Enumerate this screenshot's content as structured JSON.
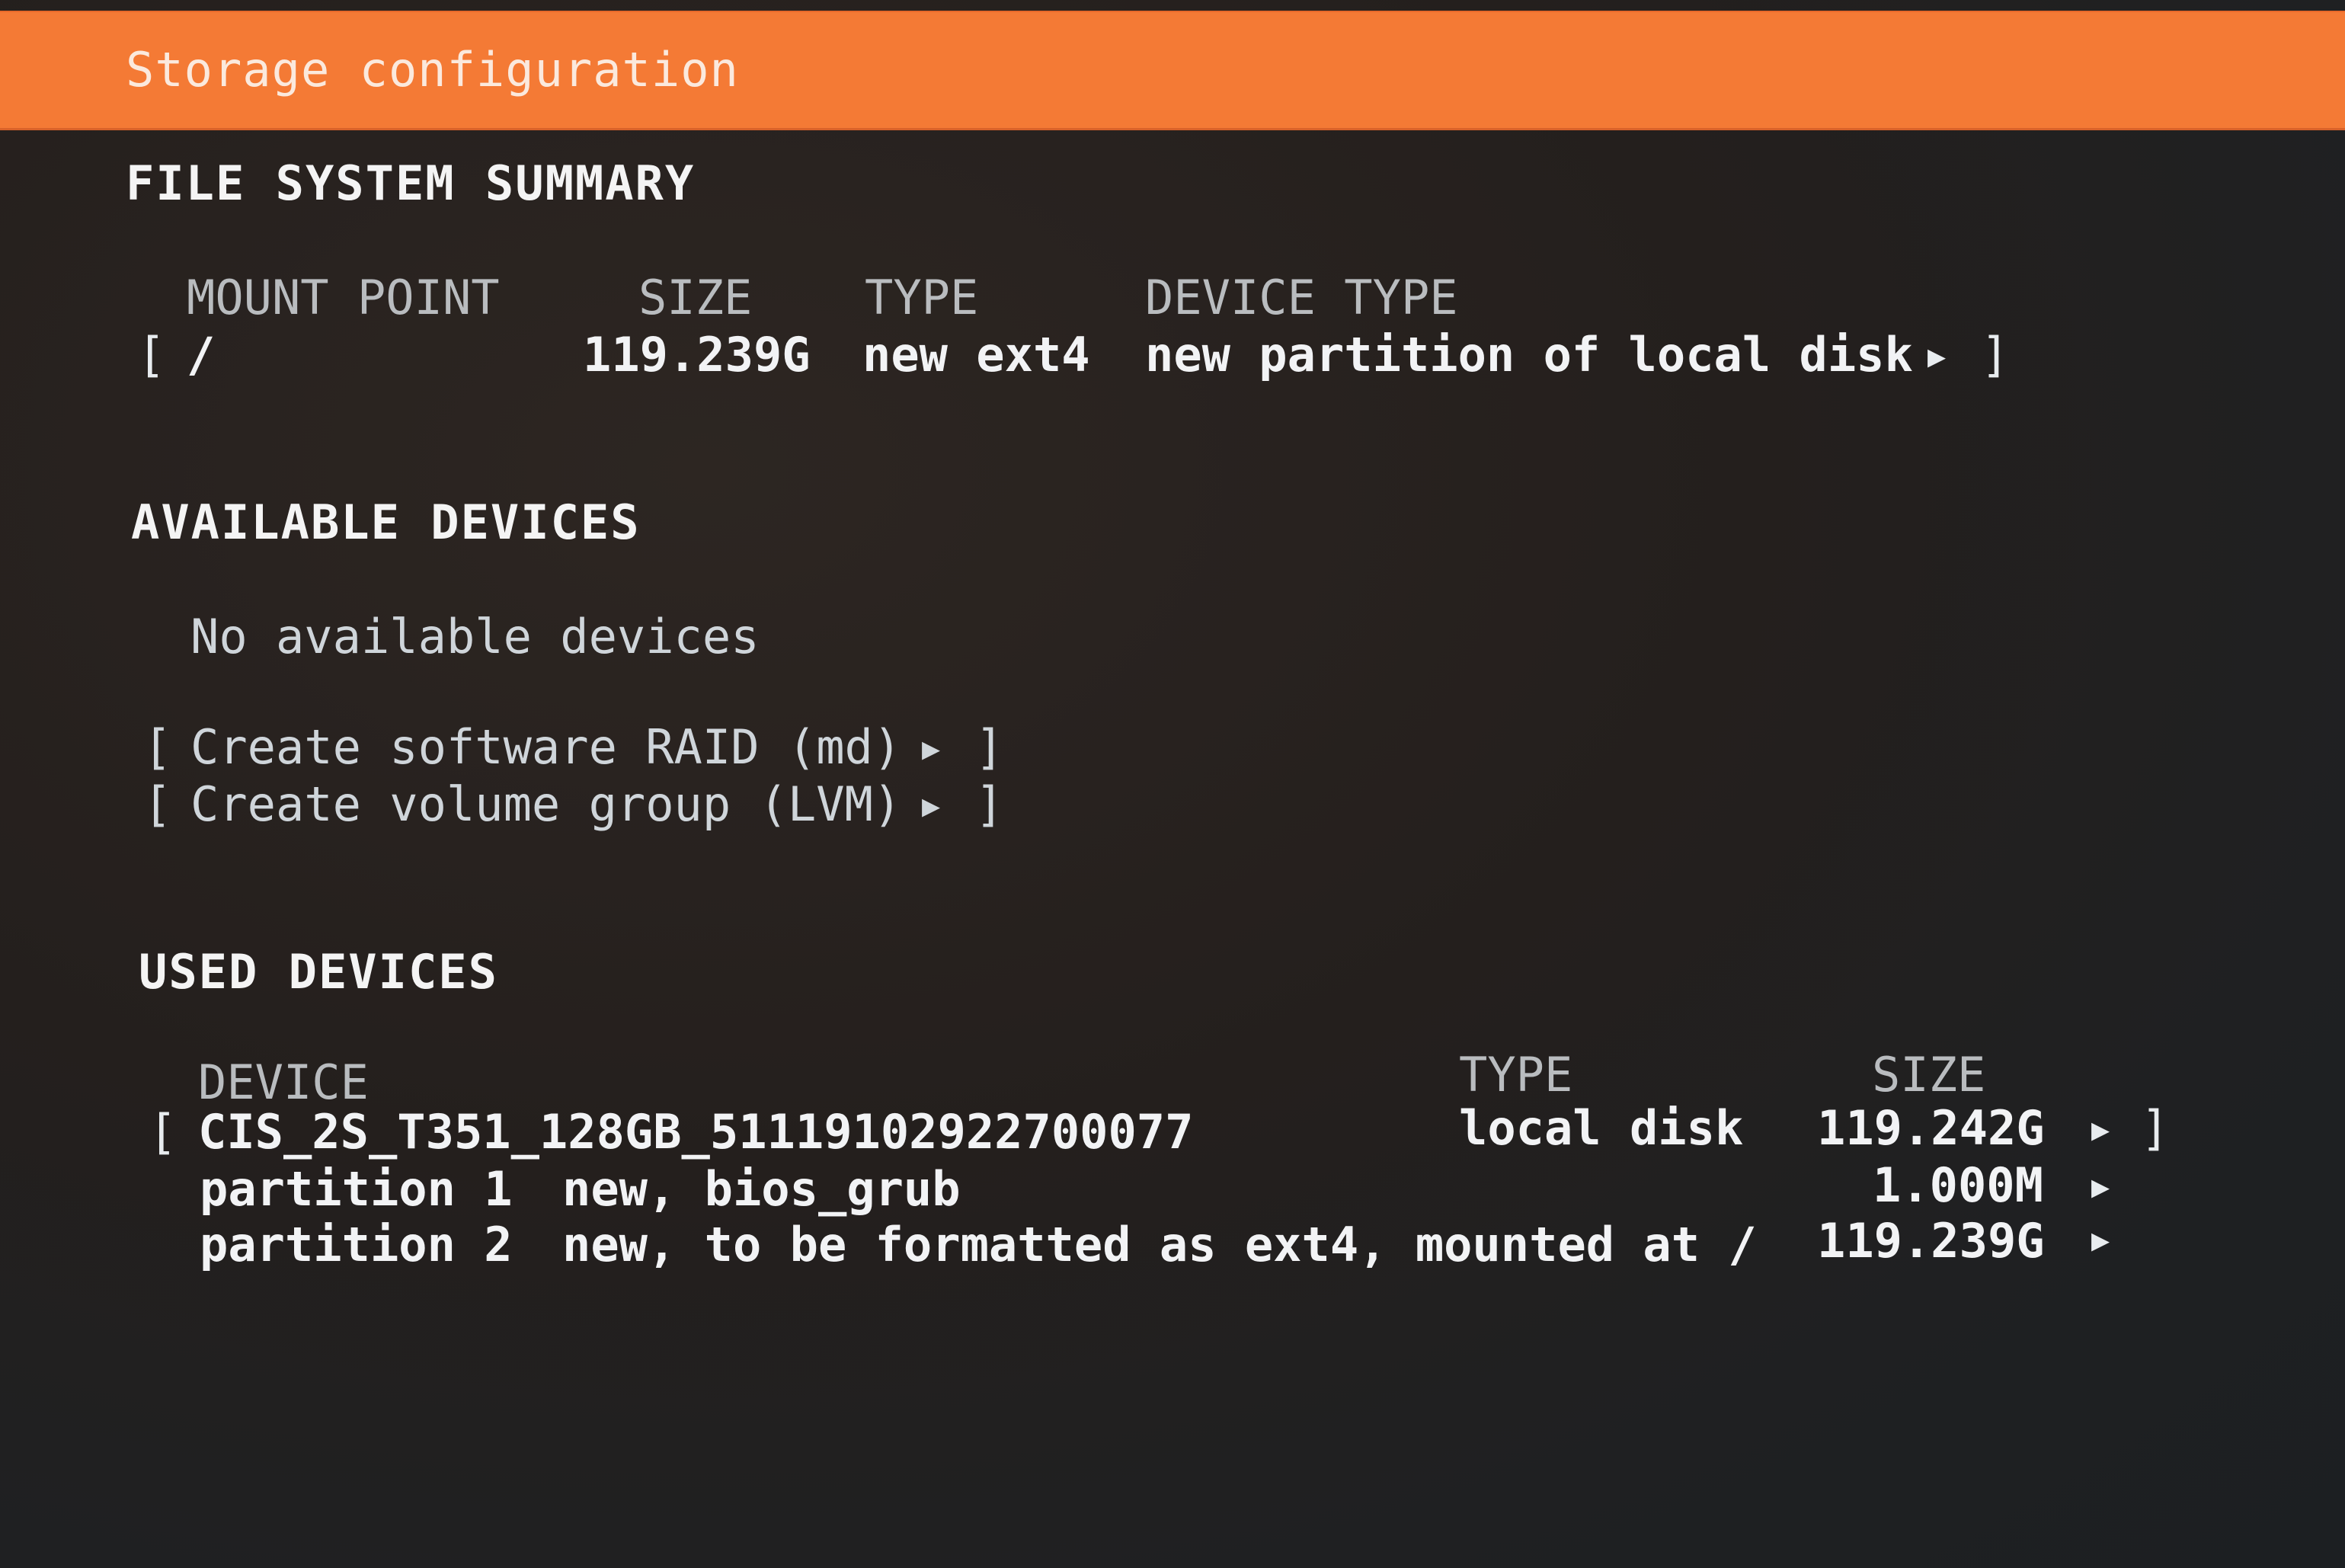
{
  "header": {
    "title": "Storage configuration",
    "bar_color": "#f47a35"
  },
  "filesystem_summary": {
    "title": "FILE SYSTEM SUMMARY",
    "columns": {
      "mount_point": "MOUNT POINT",
      "size": "SIZE",
      "type": "TYPE",
      "device_type": "DEVICE TYPE"
    },
    "rows": [
      {
        "open_bracket": "[",
        "mount_point": "/",
        "size": "119.239G",
        "type": "new ext4",
        "device_type": "new partition of local disk",
        "arrow_icon": "▶",
        "close_bracket": "]"
      }
    ]
  },
  "available_devices": {
    "title": "AVAILABLE DEVICES",
    "empty_message": "No available devices",
    "actions": [
      {
        "open_bracket": "[",
        "label": "Create software RAID (md)",
        "arrow_icon": "▶",
        "close_bracket": "]"
      },
      {
        "open_bracket": "[",
        "label": "Create volume group (LVM)",
        "arrow_icon": "▶",
        "close_bracket": "]"
      }
    ]
  },
  "used_devices": {
    "title": "USED DEVICES",
    "columns": {
      "device": "DEVICE",
      "type": "TYPE",
      "size": "SIZE"
    },
    "disk": {
      "open_bracket": "[",
      "name": "CIS_2S_T351_128GB_51119102922700077",
      "type": "local disk",
      "size": "119.242G",
      "arrow_icon": "▶",
      "close_bracket": "]"
    },
    "partitions": [
      {
        "name": "partition 1",
        "description": "new, bios_grub",
        "size": "1.000M",
        "arrow_icon": "▶"
      },
      {
        "name": "partition 2",
        "description": "new, to be formatted as ext4, mounted at /",
        "size": "119.239G",
        "arrow_icon": "▶"
      }
    ]
  }
}
